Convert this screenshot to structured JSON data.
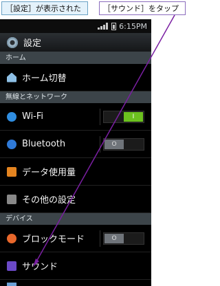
{
  "callouts": {
    "left": "［設定］が表示された",
    "right": "［サウンド］をタップ"
  },
  "status": {
    "time": "6:15PM"
  },
  "header": {
    "title": "設定"
  },
  "sections": {
    "home": "ホーム",
    "wireless": "無線とネットワーク",
    "device": "デバイス"
  },
  "items": {
    "home_switch": "ホーム切替",
    "wifi": "Wi-Fi",
    "bluetooth": "Bluetooth",
    "data_usage": "データ使用量",
    "other": "その他の設定",
    "block_mode": "ブロックモード",
    "sound": "サウンド"
  },
  "toggles": {
    "on_text": "I",
    "off_text": "O"
  },
  "colors": {
    "accent_green": "#6cc11f",
    "callout_purple": "#7a1fa2"
  }
}
